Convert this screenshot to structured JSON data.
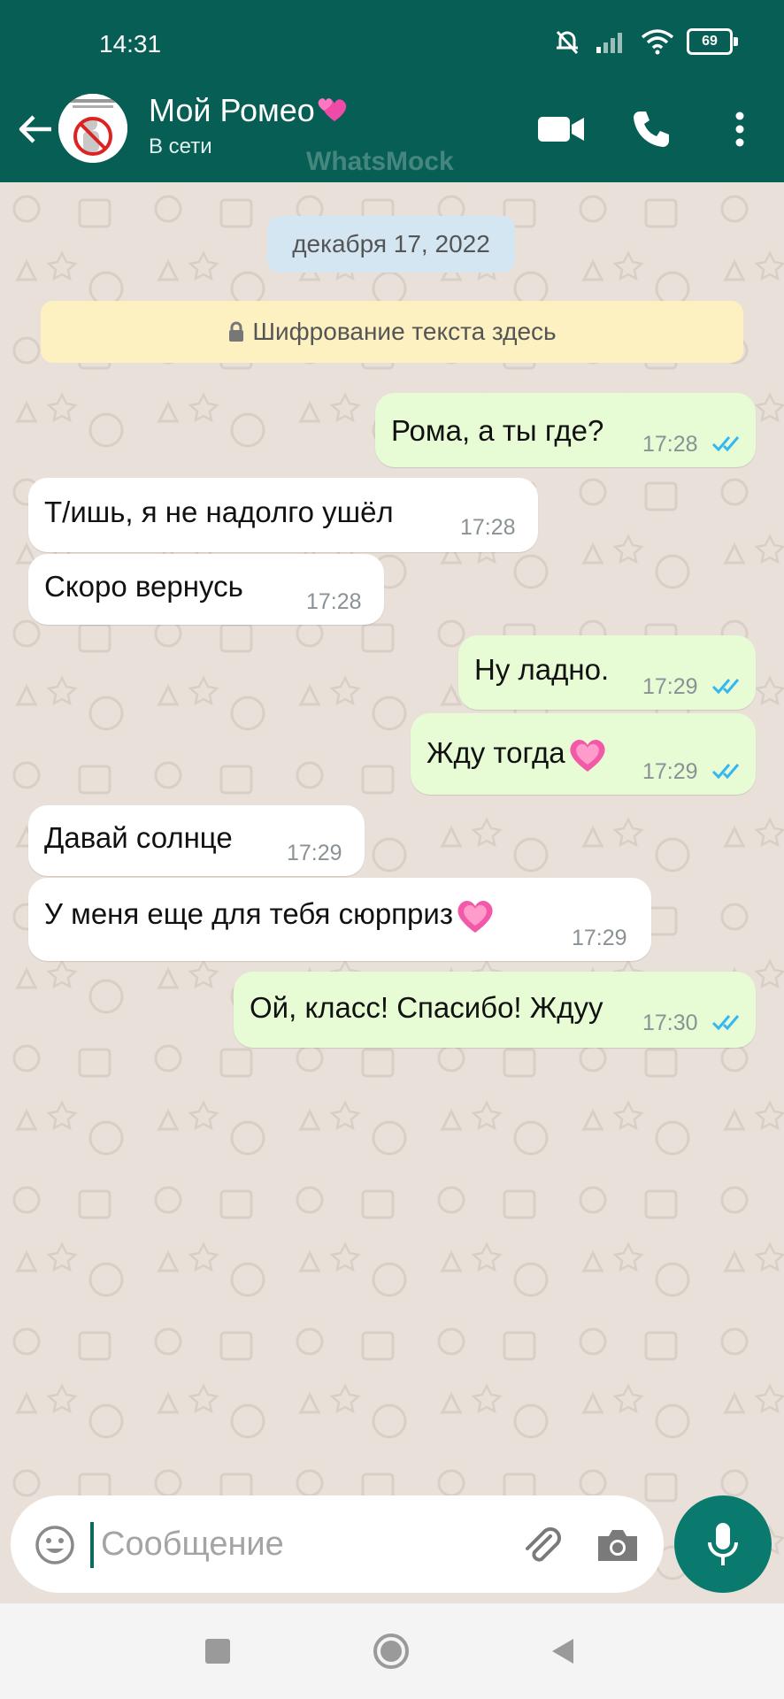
{
  "status_bar": {
    "time": "14:31",
    "battery": "69"
  },
  "header": {
    "contact_name": "Мой Ромео",
    "contact_status": "В сети",
    "watermark": "WhatsMock",
    "icons": [
      "back-arrow-icon",
      "video-call-icon",
      "phone-icon",
      "more-vert-icon"
    ]
  },
  "chat": {
    "date_chip": "декабря 17, 2022",
    "encryption_notice": "Шифрование текста здесь",
    "messages": [
      {
        "direction": "out",
        "text": "Рома, а ты где?",
        "time": "17:28",
        "read": true
      },
      {
        "direction": "in",
        "text": "Т/ишь, я не надолго ушёл",
        "time": "17:28"
      },
      {
        "direction": "in",
        "text": "Скоро вернусь",
        "time": "17:28"
      },
      {
        "direction": "out",
        "text": "Ну ладно.",
        "time": "17:29",
        "read": true
      },
      {
        "direction": "out",
        "text": "Жду тогда",
        "time": "17:29",
        "read": true,
        "emoji": "heart"
      },
      {
        "direction": "in",
        "text": "Давай солнце",
        "time": "17:29"
      },
      {
        "direction": "in",
        "text": "У меня еще для тебя сюрприз",
        "time": "17:29",
        "emoji": "heart"
      },
      {
        "direction": "out",
        "text": "Ой, класс! Спасибо! Ждуу",
        "time": "17:30",
        "read": true
      }
    ]
  },
  "composer": {
    "placeholder": "Сообщение",
    "value": ""
  },
  "colors": {
    "header": "#075e54",
    "outgoing_bubble": "#e7fcd4",
    "incoming_bubble": "#ffffff",
    "read_ticks": "#34b7f1",
    "mic_button": "#0b7a6e"
  }
}
